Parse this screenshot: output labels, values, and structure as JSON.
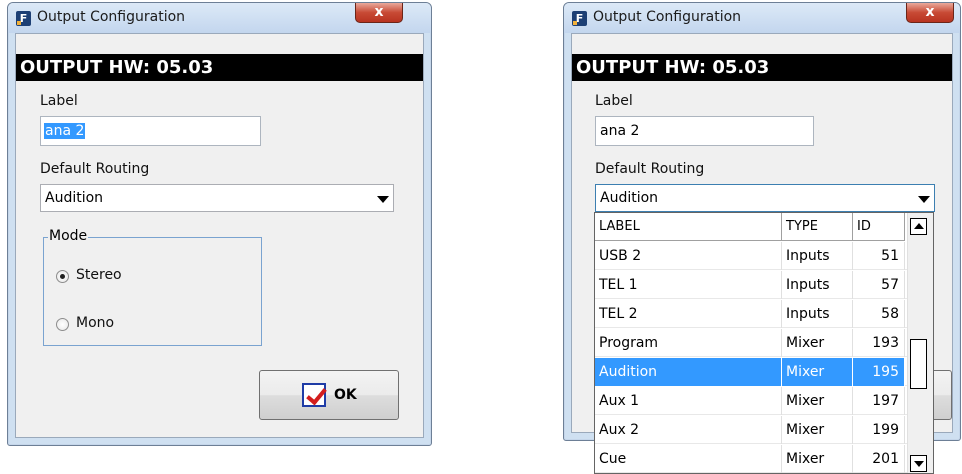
{
  "left_dialog": {
    "title": "Output Configuration",
    "app_icon": "F",
    "close_label": "x",
    "hw_header": "OUTPUT HW: 05.03",
    "label_caption": "Label",
    "label_value": "ana 2",
    "routing_caption": "Default Routing",
    "routing_value": "Audition",
    "mode_caption": "Mode",
    "mode_options": [
      {
        "label": "Stereo",
        "checked": true
      },
      {
        "label": "Mono",
        "checked": false
      }
    ],
    "ok_label": "OK"
  },
  "right_dialog": {
    "title": "Output Configuration",
    "app_icon": "F",
    "close_label": "x",
    "hw_header": "OUTPUT HW: 05.03",
    "label_caption": "Label",
    "label_value": "ana 2",
    "routing_caption": "Default Routing",
    "routing_value": "Audition",
    "dropdown": {
      "columns": [
        "LABEL",
        "TYPE",
        "ID"
      ],
      "rows": [
        {
          "label": "USB 2",
          "type": "Inputs",
          "id": "51"
        },
        {
          "label": "TEL 1",
          "type": "Inputs",
          "id": "57"
        },
        {
          "label": "TEL 2",
          "type": "Inputs",
          "id": "58"
        },
        {
          "label": "Program",
          "type": "Mixer",
          "id": "193"
        },
        {
          "label": "Audition",
          "type": "Mixer",
          "id": "195",
          "selected": true
        },
        {
          "label": "Aux 1",
          "type": "Mixer",
          "id": "197"
        },
        {
          "label": "Aux 2",
          "type": "Mixer",
          "id": "199"
        },
        {
          "label": "Cue",
          "type": "Mixer",
          "id": "201"
        }
      ]
    }
  },
  "colors": {
    "selection": "#3399ff",
    "close_button": "#c84a35",
    "window_frame": "#cfe0f1",
    "header_bar": "#000000"
  },
  "icons": [
    "app-logo-icon",
    "close-icon",
    "radio-icon",
    "ok-check-icon",
    "chevron-down-icon",
    "scroll-up-icon",
    "scroll-down-icon"
  ]
}
